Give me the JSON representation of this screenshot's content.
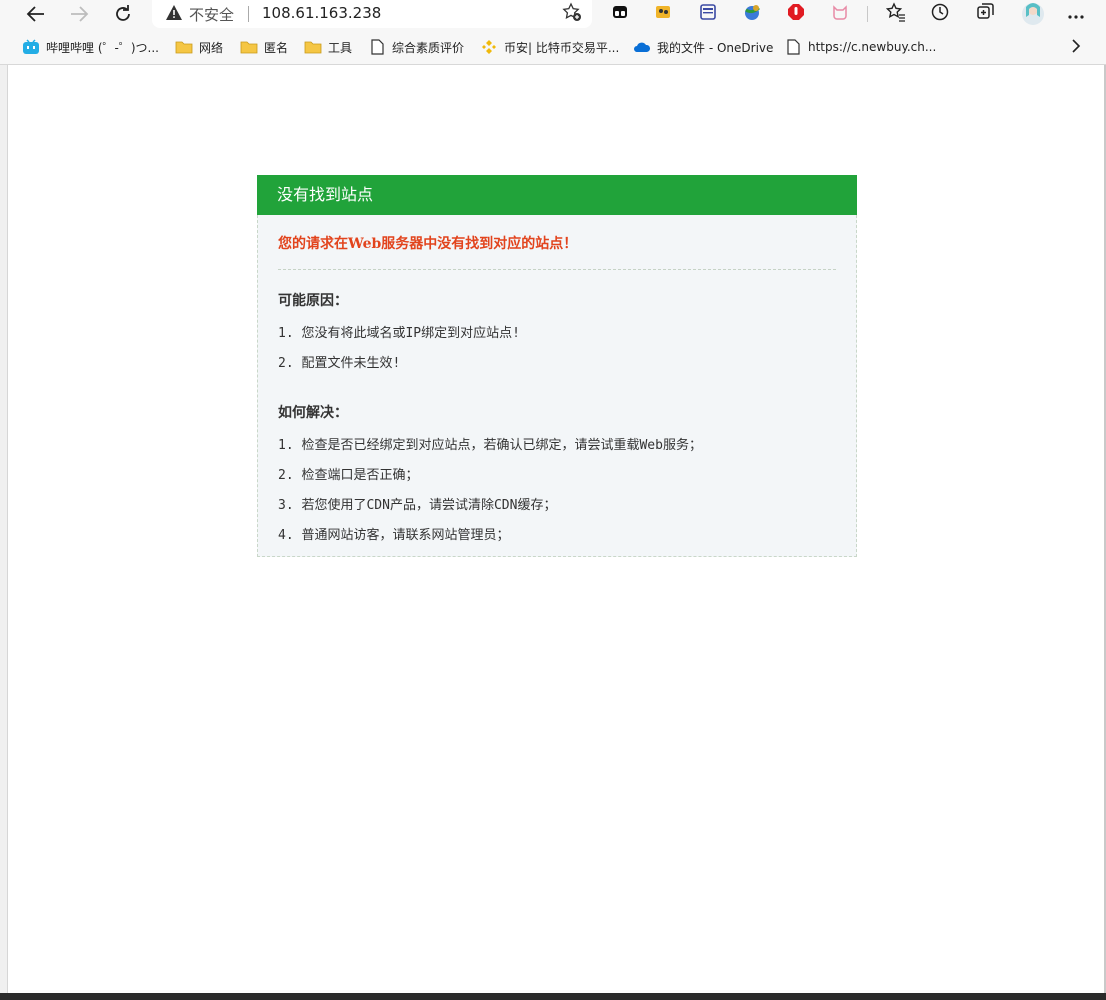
{
  "browser": {
    "security_label": "不安全",
    "url": "108.61.163.238"
  },
  "bookmarks": [
    {
      "label": "哔哩哔哩 (゜-゜)つ...",
      "icon": "bilibili-icon"
    },
    {
      "label": "网络",
      "icon": "folder-icon"
    },
    {
      "label": "匿名",
      "icon": "folder-icon"
    },
    {
      "label": "工具",
      "icon": "folder-icon"
    },
    {
      "label": "综合素质评价",
      "icon": "page-icon"
    },
    {
      "label": "币安| 比特币交易平...",
      "icon": "binance-icon"
    },
    {
      "label": "我的文件 - OneDrive",
      "icon": "onedrive-icon"
    },
    {
      "label": "https://c.newbuy.ch...",
      "icon": "page-icon"
    }
  ],
  "page": {
    "header": "没有找到站点",
    "headline": "您的请求在Web服务器中没有找到对应的站点！",
    "reasons_title": "可能原因：",
    "reasons": [
      "1. 您没有将此域名或IP绑定到对应站点!",
      "2. 配置文件未生效!"
    ],
    "solutions_title": "如何解决：",
    "solutions": [
      "1. 检查是否已经绑定到对应站点，若确认已绑定，请尝试重载Web服务；",
      "2. 检查端口是否正确；",
      "3. 若您使用了CDN产品，请尝试清除CDN缓存；",
      "4. 普通网站访客，请联系网站管理员；"
    ]
  },
  "colors": {
    "header_green": "#21a33a",
    "headline_red": "#e2441d",
    "body_bg": "#f3f6f8"
  }
}
